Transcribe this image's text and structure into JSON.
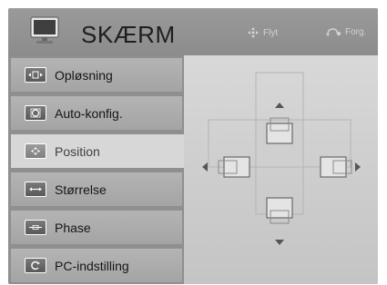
{
  "header": {
    "title": "SKÆRM",
    "hint_move": "Flyt",
    "hint_back": "Forg."
  },
  "menu": {
    "items": [
      {
        "label": "Opløsning",
        "icon": "resolution-icon"
      },
      {
        "label": "Auto-konfig.",
        "icon": "auto-config-icon"
      },
      {
        "label": "Position",
        "icon": "position-icon",
        "selected": true
      },
      {
        "label": "Størrelse",
        "icon": "size-icon"
      },
      {
        "label": "Phase",
        "icon": "phase-icon"
      },
      {
        "label": "PC-indstilling",
        "icon": "pc-setting-icon"
      }
    ]
  },
  "position_pad": {
    "controls": [
      "up",
      "left",
      "right",
      "down"
    ]
  }
}
